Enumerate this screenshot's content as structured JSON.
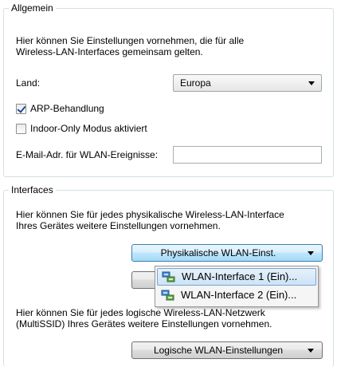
{
  "general": {
    "legend": "Allgemein",
    "description_line1": "Hier können Sie Einstellungen vornehmen, die für alle",
    "description_line2": "Wireless-LAN-Interfaces gemeinsam gelten.",
    "country_label": "Land:",
    "country_value": "Europa",
    "arp_label": "ARP-Behandlung",
    "arp_checked": true,
    "indoor_label": "Indoor-Only Modus aktiviert",
    "indoor_checked": false,
    "email_label": "E-Mail-Adr. für WLAN-Ereignisse:",
    "email_value": ""
  },
  "interfaces": {
    "legend": "Interfaces",
    "physical_desc_line1": "Hier können Sie für jedes physikalische Wireless-LAN-Interface",
    "physical_desc_line2": "Ihres Gerätes weitere Einstellungen vornehmen.",
    "physical_button": "Physikalische WLAN-Einst.",
    "logical_desc_line1": "Hier können Sie für jedes logische Wireless-LAN-Netzwerk",
    "logical_desc_line2": "(MultiSSID) Ihres Gerätes weitere Einstellungen vornehmen.",
    "logical_button": "Logische WLAN-Einstellungen"
  },
  "dropdown_menu": {
    "items": [
      {
        "label": "WLAN-Interface 1 (Ein)...",
        "icon": "network-adapter-icon",
        "selected": true
      },
      {
        "label": "WLAN-Interface 2 (Ein)...",
        "icon": "network-adapter-icon",
        "selected": false
      }
    ]
  },
  "colors": {
    "accent": "#3c7fb1",
    "group_border": "#d5dfe5",
    "menu_highlight": "#cde3f7"
  }
}
